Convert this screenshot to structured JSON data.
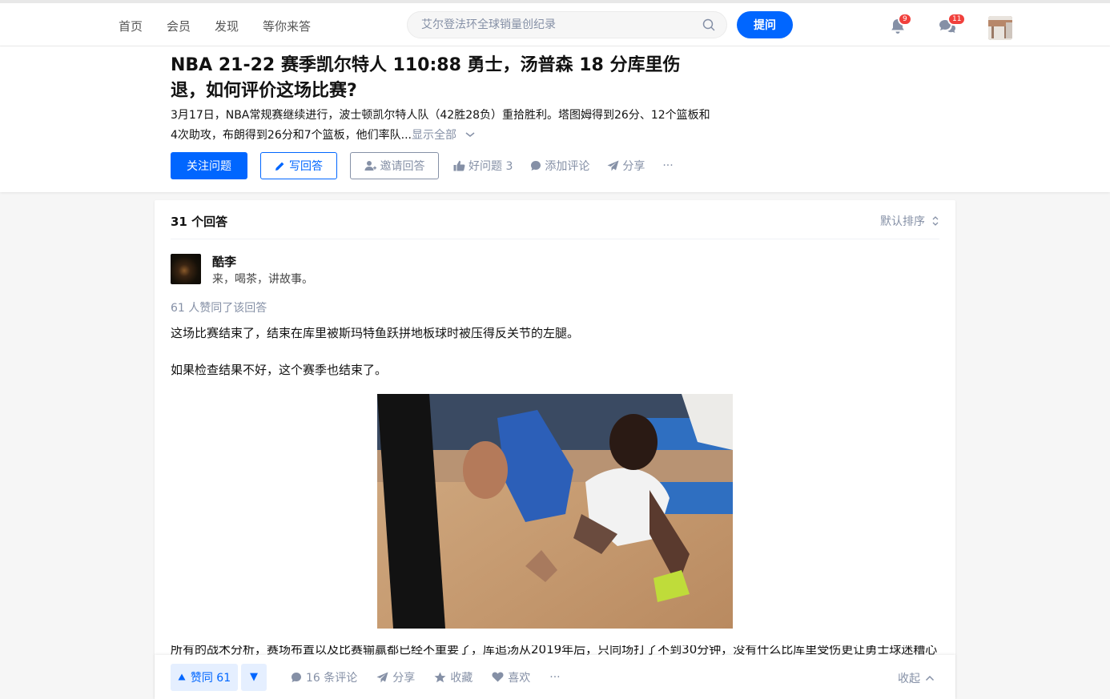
{
  "nav": {
    "items": [
      "首页",
      "会员",
      "发现",
      "等你来答"
    ]
  },
  "search": {
    "placeholder": "艾尔登法环全球销量创纪录"
  },
  "header": {
    "ask_label": "提问",
    "notifications_count": "9",
    "messages_count": "11"
  },
  "question": {
    "title": "NBA 21-22 赛季凯尔特人 110:88 勇士，汤普森 18 分库里伤退，如何评价这场比赛?",
    "description": "3月17日，NBA常规赛继续进行，波士顿凯尔特人队（42胜28负）重拾胜利。塔图姆得到26分、12个篮板和4次助攻，布朗得到26分和7个篮板，他们率队...",
    "show_all": "显示全部",
    "follow_label": "关注问题",
    "write_label": "写回答",
    "invite_label": "邀请回答",
    "good_question_label": "好问题 3",
    "add_comment_label": "添加评论",
    "share_label": "分享",
    "more_label": "···"
  },
  "answers": {
    "count_label": "31 个回答",
    "sort_label": "默认排序"
  },
  "answer": {
    "author_name": "酷李",
    "author_bio": "来，喝茶，讲故事。",
    "votes_text": "61 人赞同了该回答",
    "paragraph_1": "这场比赛结束了，结束在库里被斯玛特鱼跃拼地板球时被压得反关节的左腿。",
    "paragraph_2": "如果检查结果不好，这个赛季也结束了。",
    "paragraph_3": "所有的战术分析，赛场布置以及比赛输赢都已经不重要了，库追汤从2019年后，只同场打了不到30分钟，没有什么比库里受伤更让勇士球迷糟心"
  },
  "actions": {
    "vote_up_label": "赞同 61",
    "vote_down_label": "▼",
    "comments_label": "16 条评论",
    "share_label": "分享",
    "collect_label": "收藏",
    "like_label": "喜欢",
    "more_label": "···",
    "collapse_label": "收起"
  },
  "colors": {
    "brand": "#0066ff",
    "muted": "#8590a6",
    "badge": "#f1403c"
  }
}
